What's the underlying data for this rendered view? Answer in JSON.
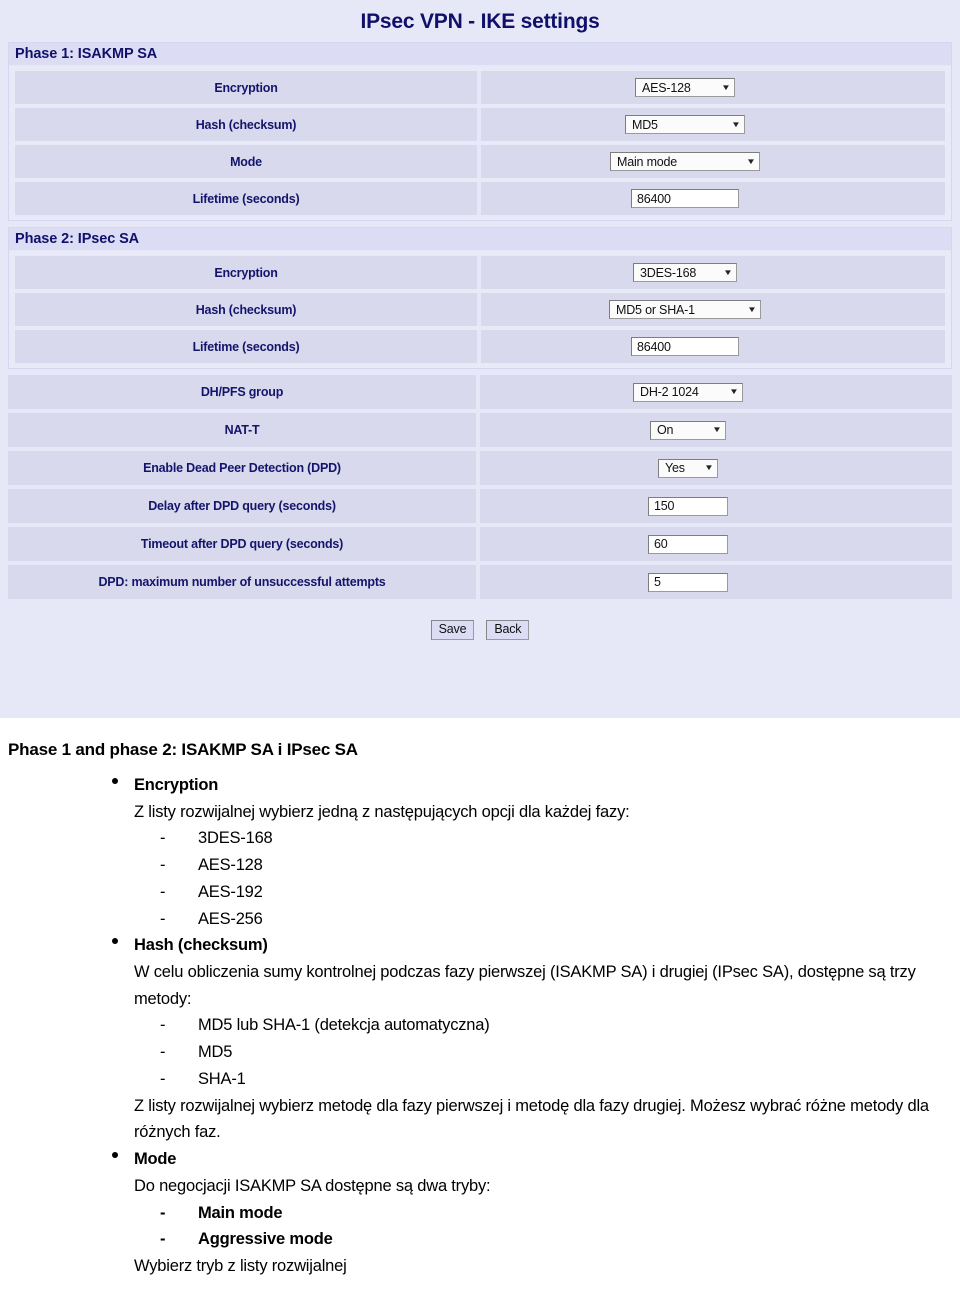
{
  "router_ui": {
    "title": "IPsec VPN - IKE settings",
    "sections": [
      {
        "header": "Phase 1: ISAKMP SA",
        "rows": [
          {
            "label": "Encryption",
            "control": "select",
            "value": "AES-128"
          },
          {
            "label": "Hash (checksum)",
            "control": "select",
            "value": "MD5"
          },
          {
            "label": "Mode",
            "control": "select",
            "value": "Main mode"
          },
          {
            "label": "Lifetime (seconds)",
            "control": "text",
            "value": "86400"
          }
        ]
      },
      {
        "header": "Phase 2: IPsec SA",
        "rows": [
          {
            "label": "Encryption",
            "control": "select",
            "value": "3DES-168"
          },
          {
            "label": "Hash (checksum)",
            "control": "select",
            "value": "MD5 or SHA-1"
          },
          {
            "label": "Lifetime (seconds)",
            "control": "text",
            "value": "86400"
          }
        ]
      },
      {
        "header": "",
        "rows": [
          {
            "label": "DH/PFS group",
            "control": "select",
            "value": "DH-2 1024"
          },
          {
            "label": "NAT-T",
            "control": "select",
            "value": "On"
          },
          {
            "label": "Enable Dead Peer Detection (DPD)",
            "control": "select",
            "value": "Yes"
          },
          {
            "label": "Delay after DPD query (seconds)",
            "control": "text",
            "value": "150"
          },
          {
            "label": "Timeout after DPD query (seconds)",
            "control": "text",
            "value": "60"
          },
          {
            "label": "DPD: maximum number of unsuccessful attempts",
            "control": "text",
            "value": "5"
          }
        ]
      }
    ],
    "buttons": {
      "save": "Save",
      "back": "Back"
    },
    "colors": {
      "page_background": "#e7e8f7",
      "section_header": "#dcdcf4",
      "row_background": "#d8d9ec",
      "title_text": "#10106a",
      "label_text": "#14146d"
    }
  },
  "document": {
    "heading": "Phase 1 and phase 2: ISAKMP SA i IPsec SA",
    "bullets": [
      {
        "title": "Encryption",
        "paragraphs": [
          "Z listy rozwijalnej wybierz jedną z następujących opcji dla każdej fazy:"
        ],
        "items": [
          "3DES-168",
          "AES-128",
          "AES-192",
          "AES-256"
        ],
        "items_bold": false,
        "paragraphs_after": []
      },
      {
        "title": "Hash (checksum)",
        "paragraphs": [
          "W celu obliczenia sumy kontrolnej podczas fazy pierwszej (ISAKMP SA) i drugiej (IPsec SA), dostępne są trzy metody:"
        ],
        "items": [
          "MD5 lub SHA-1 (detekcja automatyczna)",
          "MD5",
          "SHA-1"
        ],
        "items_bold": false,
        "paragraphs_after": [
          "Z listy rozwijalnej wybierz metodę dla fazy pierwszej i metodę dla fazy drugiej. Możesz wybrać różne metody dla różnych faz."
        ]
      },
      {
        "title": "Mode",
        "paragraphs": [
          "Do negocjacji ISAKMP SA dostępne są dwa tryby:"
        ],
        "items": [
          "Main mode",
          "Aggressive mode"
        ],
        "items_bold": true,
        "paragraphs_after": [
          "Wybierz tryb z listy rozwijalnej"
        ]
      }
    ],
    "dash_glyph": "-"
  }
}
